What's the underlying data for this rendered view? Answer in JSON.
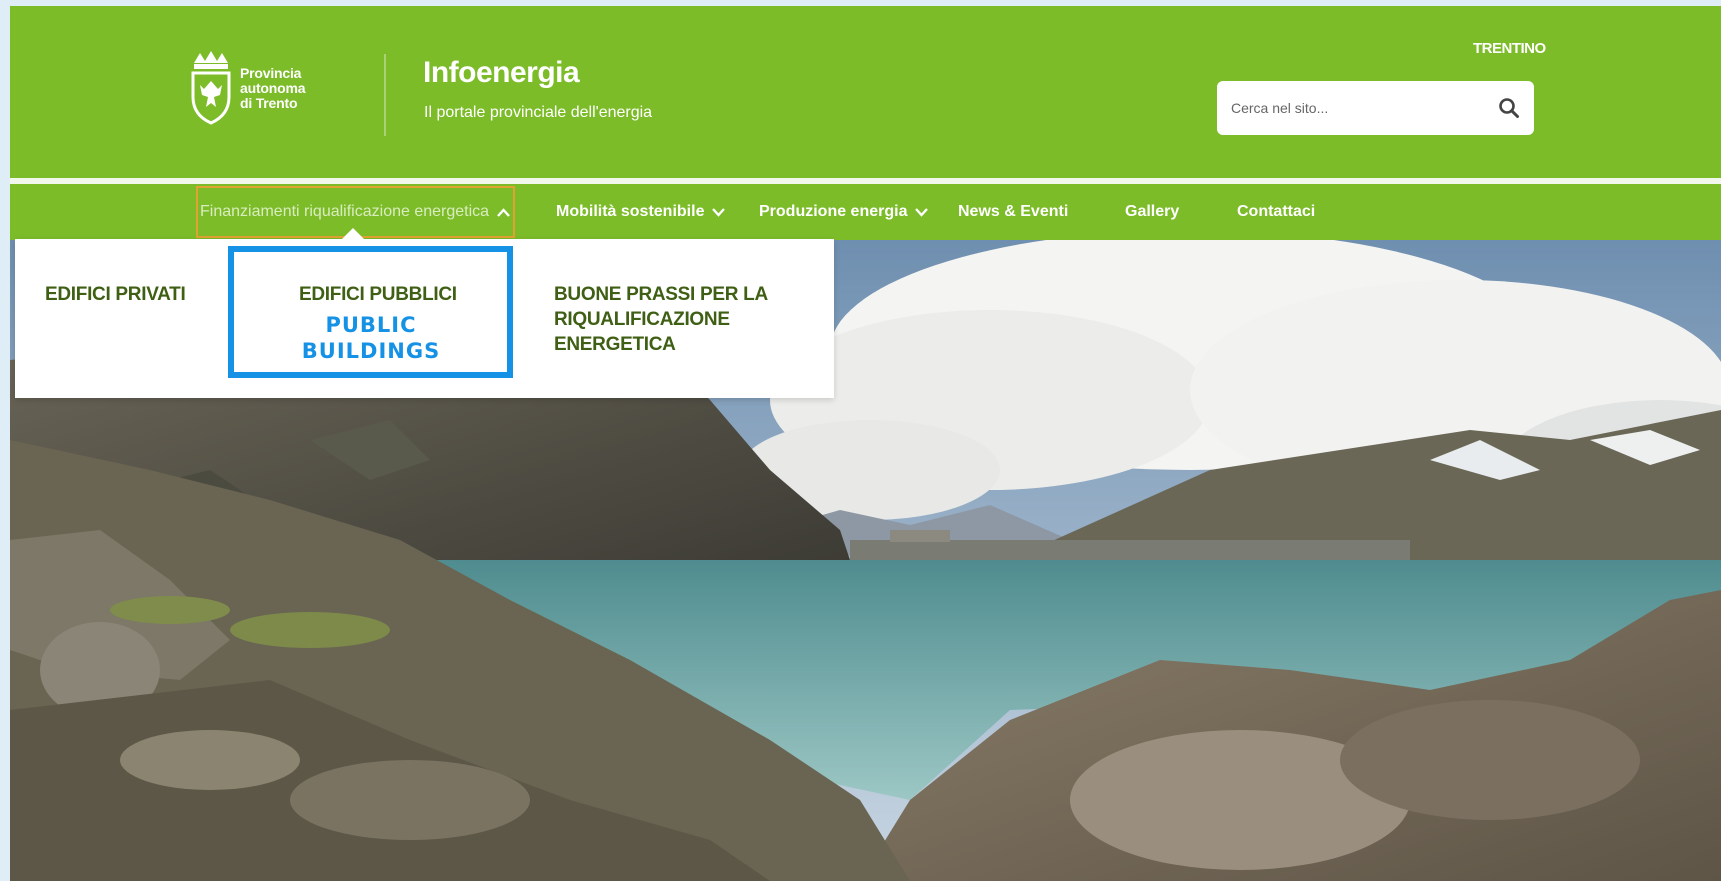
{
  "colors": {
    "brand_green": "#7cbc29",
    "menu_text": "#3f5f14",
    "annotation_blue": "#1592e6",
    "active_border": "#e0a331"
  },
  "header": {
    "logo_text": [
      "Provincia",
      "autonoma",
      "di Trento"
    ],
    "site_title": "Infoenergia",
    "site_subtitle": "Il portale provinciale dell'energia",
    "brand_mark": "TRENTINO",
    "search": {
      "placeholder": "Cerca nel sito...",
      "icon": "search-icon"
    }
  },
  "nav": {
    "items": [
      {
        "label": "Finanziamenti riqualificazione energetica",
        "chevron": "up",
        "active": true
      },
      {
        "label": "Mobilità sostenibile",
        "chevron": "down"
      },
      {
        "label": "Produzione energia",
        "chevron": "down"
      },
      {
        "label": "News & Eventi"
      },
      {
        "label": "Gallery"
      },
      {
        "label": "Contattaci"
      }
    ]
  },
  "dropdown": {
    "items": [
      {
        "label": "EDIFICI PRIVATI"
      },
      {
        "label": "EDIFICI PUBBLICI"
      },
      {
        "label": "BUONE PRASSI PER LA RIQUALIFICAZIONE ENERGETICA"
      }
    ]
  },
  "annotation": {
    "lines": [
      "PUBLIC",
      "BUILDINGS"
    ]
  }
}
